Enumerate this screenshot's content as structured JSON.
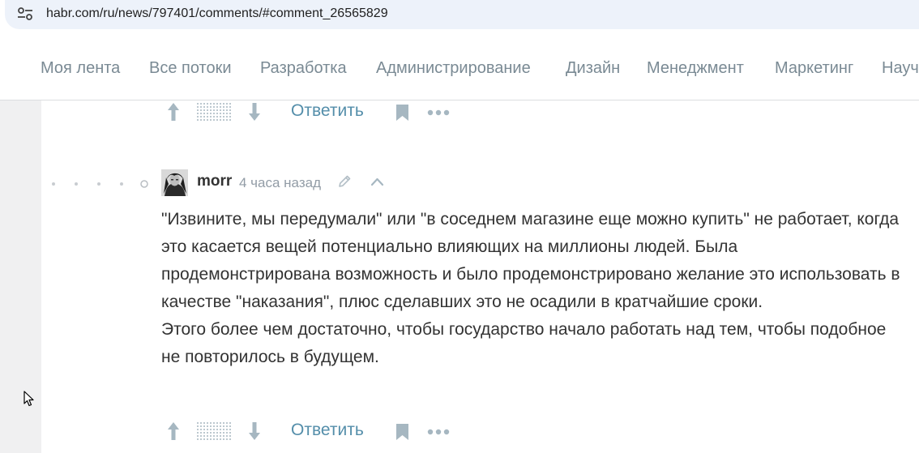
{
  "browser": {
    "url": "habr.com/ru/news/797401/comments/#comment_26565829",
    "site_info_icon": "tune-icon"
  },
  "nav": {
    "items": [
      "Моя лента",
      "Все потоки",
      "Разработка",
      "Администрирование",
      "Дизайн",
      "Менеджмент",
      "Маркетинг",
      "Науч"
    ]
  },
  "top_action_bar": {
    "reply_label": "Ответить",
    "icons": [
      "arrow-up-icon",
      "score-hidden-icon",
      "arrow-down-icon",
      "bookmark-icon",
      "more-icon"
    ]
  },
  "comment": {
    "username": "morr",
    "timestamp": "4 часа назад",
    "paragraphs": [
      "\"Извините, мы передумали\" или \"в соседнем магазине еще можно купить\" не работает, когда это касается вещей потенциально влияющих на миллионы людей. Была продемонстрирована возможность и было продемонстрировано желание это использовать в качестве \"наказания\", плюс сделавших это не осадили в кратчайшие сроки.",
      "Этого более чем достаточно, чтобы государство начало работать над тем, чтобы подобное не повторилось в будущем."
    ],
    "reply_label": "Ответить"
  },
  "colors": {
    "link": "#548eaa",
    "nav_text": "#7a8a94",
    "icon": "#a6b7c1",
    "text": "#333333"
  }
}
